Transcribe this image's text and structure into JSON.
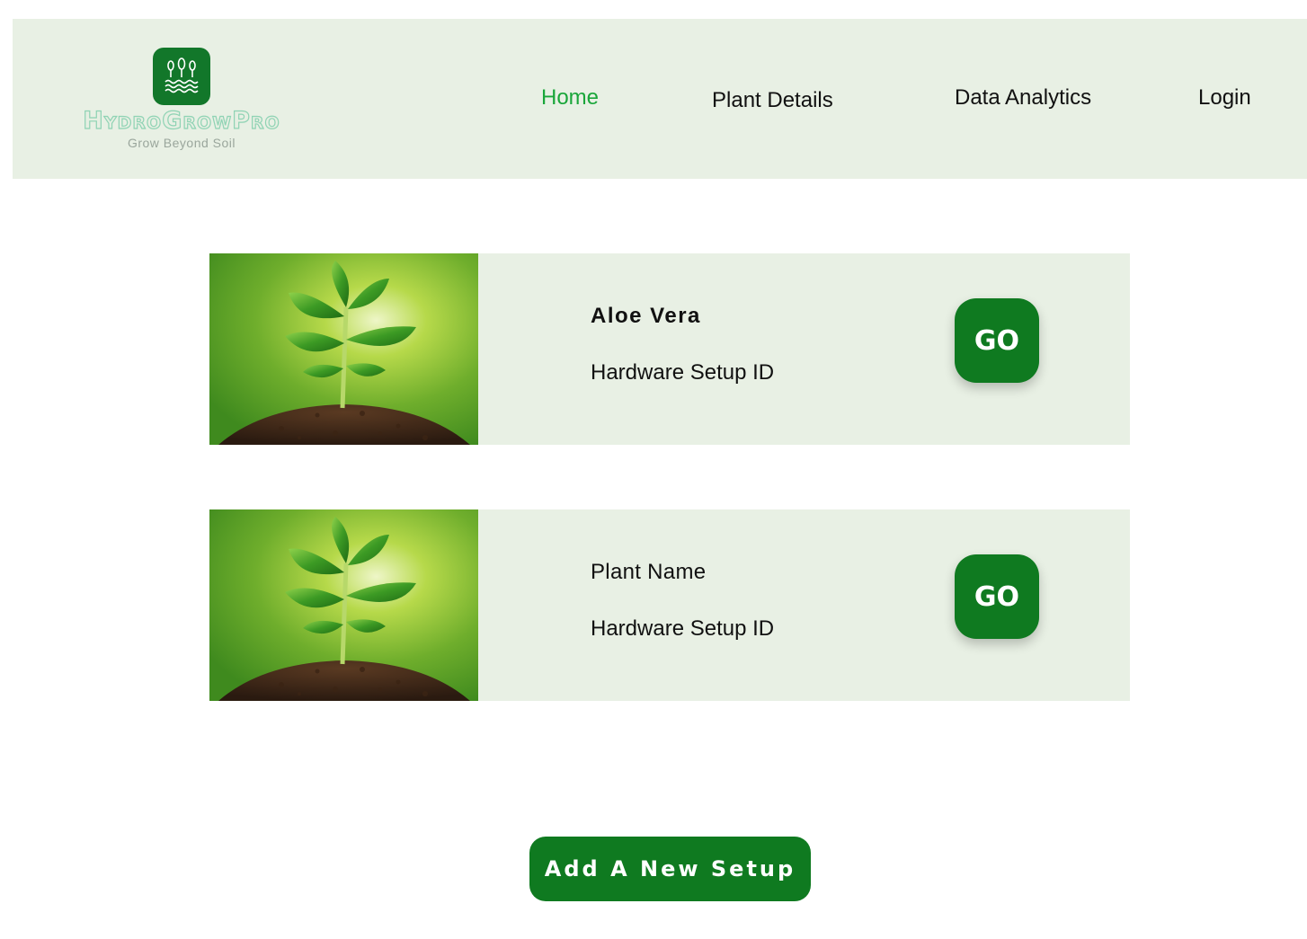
{
  "brand": {
    "name": "HydroGrowPro",
    "tagline": "Grow Beyond Soil",
    "logo_icon": "plants-water-icon",
    "primary_color": "#0f7a20",
    "header_bg": "#e8f0e4",
    "active_nav_color": "#1aa63a"
  },
  "nav": {
    "items": [
      {
        "label": "Home",
        "active": true
      },
      {
        "label": "Plant Details",
        "active": false
      },
      {
        "label": "Data Analytics",
        "active": false
      },
      {
        "label": "Login",
        "active": false
      }
    ]
  },
  "setups": [
    {
      "title": "Aloe Vera",
      "subtitle": "Hardware Setup ID",
      "button": "GO",
      "image": "seedling-in-soil"
    },
    {
      "title": "Plant Name",
      "subtitle": "Hardware Setup ID",
      "button": "GO",
      "image": "seedling-in-soil"
    }
  ],
  "actions": {
    "add_setup_label": "Add A New Setup"
  }
}
